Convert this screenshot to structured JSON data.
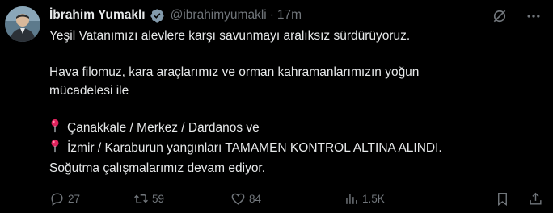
{
  "author": {
    "name": "İbrahim Yumaklı",
    "handle": "@ibrahimyumakli",
    "separator": "·",
    "time": "17m"
  },
  "tweet": {
    "line1": "Yeşil Vatanımızı alevlere karşı savunmayı aralıksız sürdürüyoruz.",
    "line2": "Hava filomuz, kara araçlarımız ve orman kahramanlarımızın yoğun",
    "line3": "mücadelesi ile",
    "line4": "Çanakkale / Merkez / Dardanos ve",
    "line5": "İzmir / Karaburun yangınları TAMAMEN KONTROL ALTINA ALINDI.",
    "line6": "Soğutma çalışmalarımız devam ediyor."
  },
  "actions": {
    "replies": "27",
    "retweets": "59",
    "likes": "84",
    "views": "1.5K"
  },
  "icons": {
    "verified": "verified-badge-icon",
    "top_left": "grok-icon",
    "top_right": "more-options-icon",
    "pin": "round-pushpin-icon",
    "reply": "reply-icon",
    "retweet": "retweet-icon",
    "like": "heart-icon",
    "views": "views-icon",
    "bookmark": "bookmark-icon",
    "share": "share-icon"
  },
  "colors": {
    "background": "#000000",
    "text": "#e7e9ea",
    "muted": "#71767b",
    "verified": "#829aab",
    "pin": "#e0245e"
  }
}
